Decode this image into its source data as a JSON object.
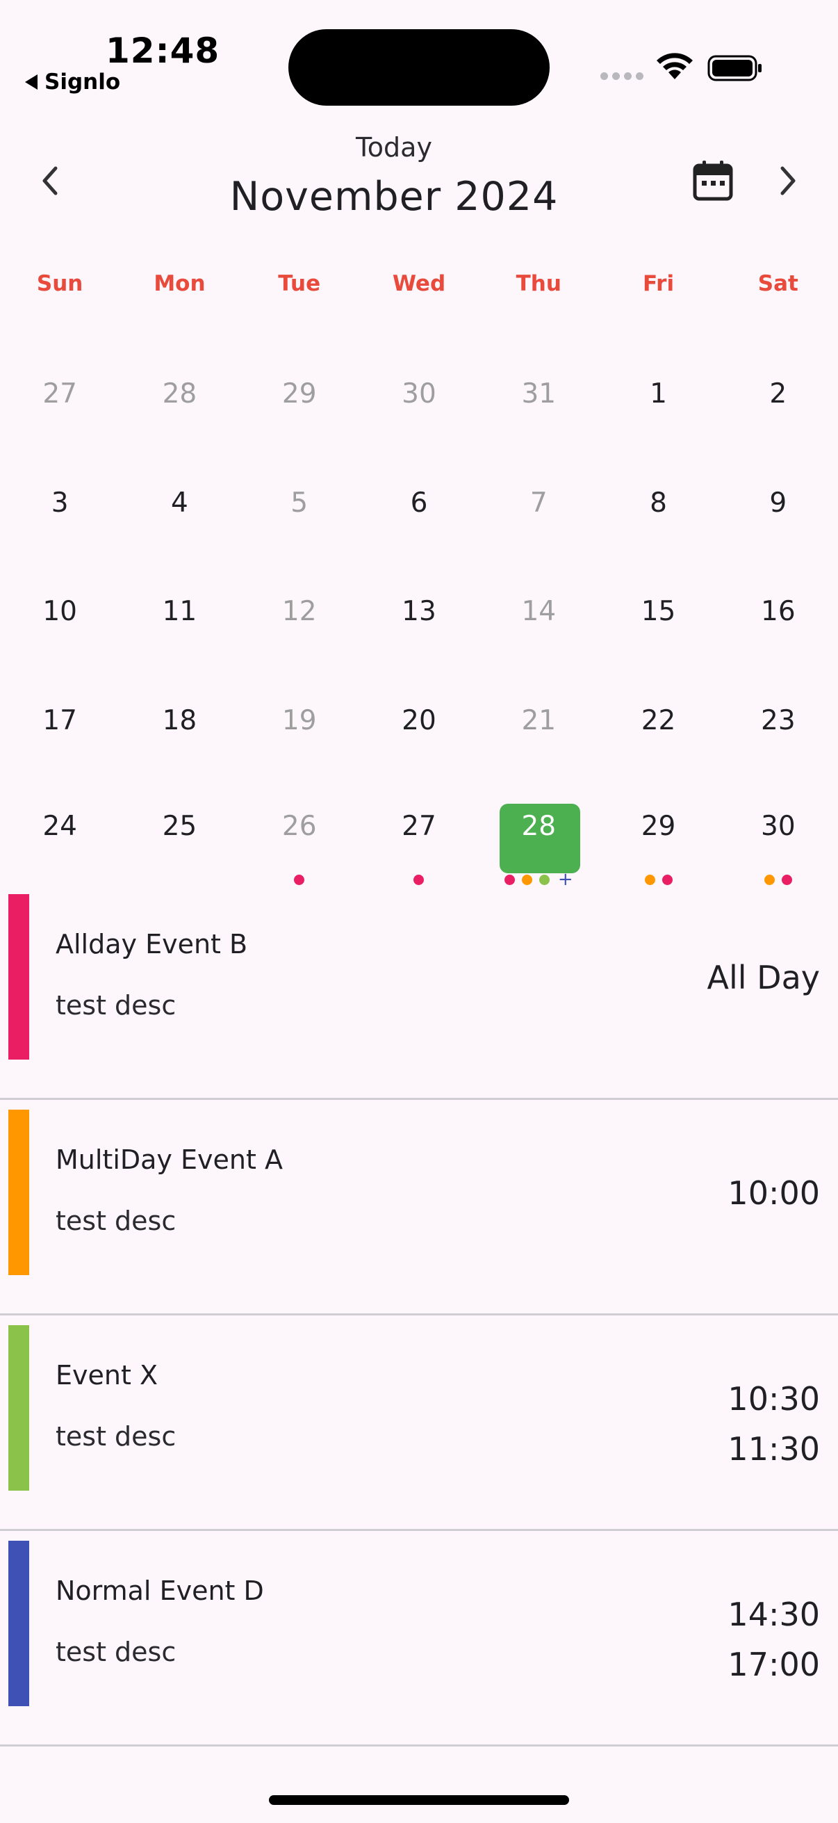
{
  "status_bar": {
    "time": "12:48",
    "back_app": "Signlo"
  },
  "header": {
    "today_label": "Today",
    "month_title": "November 2024"
  },
  "weekdays": [
    "Sun",
    "Mon",
    "Tue",
    "Wed",
    "Thu",
    "Fri",
    "Sat"
  ],
  "colors": {
    "accent_green": "#4caf50",
    "weekday_red": "#e84a3c",
    "pink": "#e91e63",
    "orange": "#ff9800",
    "green": "#8bc34a",
    "indigo": "#3f51b5"
  },
  "weeks": [
    [
      {
        "d": "27",
        "m": true
      },
      {
        "d": "28",
        "m": true
      },
      {
        "d": "29",
        "m": true
      },
      {
        "d": "30",
        "m": true
      },
      {
        "d": "31",
        "m": true
      },
      {
        "d": "1",
        "m": false
      },
      {
        "d": "2",
        "m": false
      }
    ],
    [
      {
        "d": "3",
        "m": false
      },
      {
        "d": "4",
        "m": false
      },
      {
        "d": "5",
        "m": true
      },
      {
        "d": "6",
        "m": false
      },
      {
        "d": "7",
        "m": true
      },
      {
        "d": "8",
        "m": false
      },
      {
        "d": "9",
        "m": false
      }
    ],
    [
      {
        "d": "10",
        "m": false
      },
      {
        "d": "11",
        "m": false
      },
      {
        "d": "12",
        "m": true
      },
      {
        "d": "13",
        "m": false
      },
      {
        "d": "14",
        "m": true
      },
      {
        "d": "15",
        "m": false
      },
      {
        "d": "16",
        "m": false
      }
    ],
    [
      {
        "d": "17",
        "m": false
      },
      {
        "d": "18",
        "m": false
      },
      {
        "d": "19",
        "m": true
      },
      {
        "d": "20",
        "m": false
      },
      {
        "d": "21",
        "m": true
      },
      {
        "d": "22",
        "m": false
      },
      {
        "d": "23",
        "m": false
      }
    ],
    [
      {
        "d": "24",
        "m": false
      },
      {
        "d": "25",
        "m": false
      },
      {
        "d": "26",
        "m": true,
        "dots": [
          "#e91e63"
        ]
      },
      {
        "d": "27",
        "m": false,
        "dots": [
          "#e91e63"
        ]
      },
      {
        "d": "28",
        "m": false,
        "selected": true,
        "dots": [
          "#e91e63",
          "#ff9800",
          "#8bc34a"
        ],
        "more": "+"
      },
      {
        "d": "29",
        "m": false,
        "dots": [
          "#ff9800",
          "#e91e63"
        ]
      },
      {
        "d": "30",
        "m": false,
        "dots": [
          "#ff9800",
          "#e91e63"
        ]
      }
    ]
  ],
  "events": [
    {
      "title": "Allday Event B",
      "desc": "test desc",
      "time_lines": [
        "All Day"
      ],
      "color": "#e91e63"
    },
    {
      "title": "MultiDay Event A",
      "desc": "test desc",
      "time_lines": [
        "10:00"
      ],
      "color": "#ff9800"
    },
    {
      "title": "Event X",
      "desc": "test desc",
      "time_lines": [
        "10:30",
        "11:30"
      ],
      "color": "#8bc34a"
    },
    {
      "title": "Normal Event D",
      "desc": "test desc",
      "time_lines": [
        "14:30",
        "17:00"
      ],
      "color": "#3f51b5"
    }
  ]
}
